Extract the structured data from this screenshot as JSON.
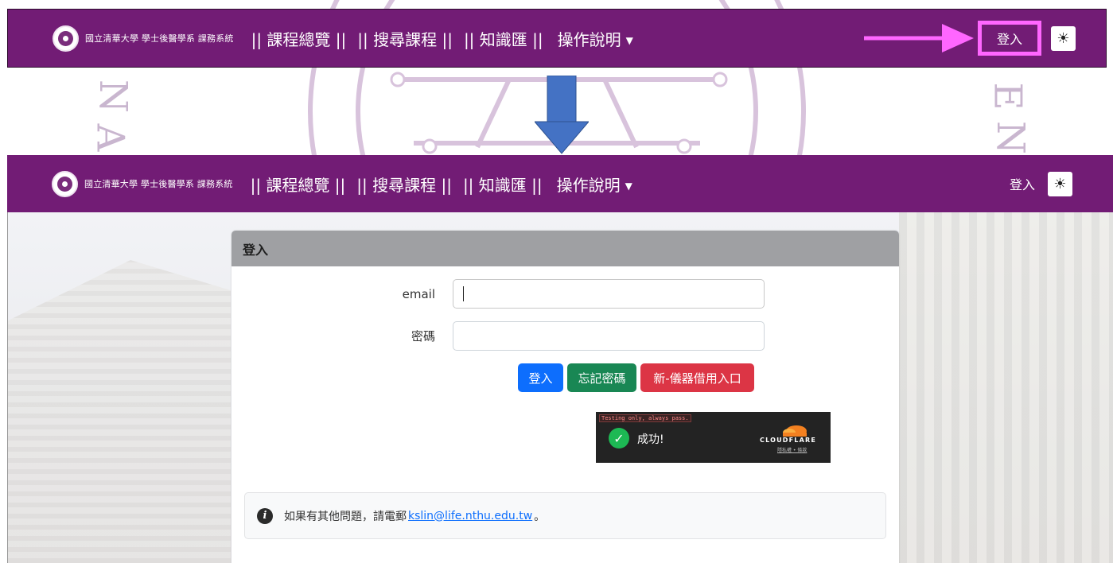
{
  "colors": {
    "navbar": "#721c75",
    "highlight": "#ff66ff",
    "arrow": "#4472c4",
    "btn_primary": "#0d6efd",
    "btn_success": "#198754",
    "btn_danger": "#dc3545",
    "card_header": "#9fa0a3"
  },
  "navbar": {
    "brand": "國立清華大學 學士後醫學系 課務系統",
    "links": [
      "|| 課程總覽 ||",
      "|| 搜尋課程 ||",
      "|| 知識匯 ||"
    ],
    "dropdown_label": "操作說明",
    "login_label": "登入",
    "theme_icon": "sun-icon",
    "theme_glyph": "☀"
  },
  "login_card": {
    "title": "登入",
    "email_label": "email",
    "email_value": "",
    "password_label": "密碼",
    "password_value": "",
    "login_button": "登入",
    "forgot_button": "忘記密碼",
    "instrument_button": "新-儀器借用入口"
  },
  "turnstile": {
    "test_note": "Testing only, always pass.",
    "success_text": "成功!",
    "brand": "CLOUDFLARE",
    "links": "隱私權 • 條款"
  },
  "info": {
    "text_before": "如果有其他問題，請電郵",
    "email": "kslin@life.nthu.edu.tw",
    "text_after": "。"
  }
}
